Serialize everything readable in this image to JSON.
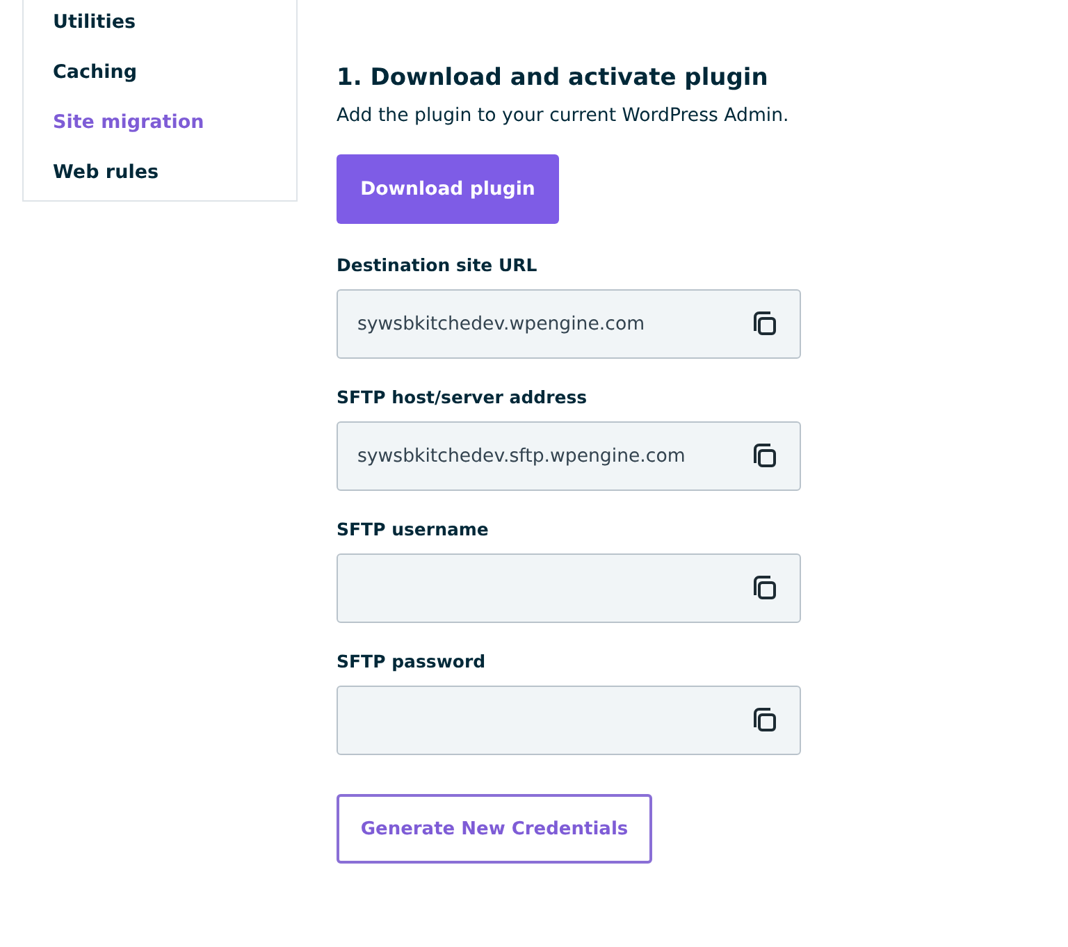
{
  "sidebar": {
    "items": [
      {
        "label": "Utilities",
        "selected": false
      },
      {
        "label": "Caching",
        "selected": false
      },
      {
        "label": "Site migration",
        "selected": true
      },
      {
        "label": "Web rules",
        "selected": false
      }
    ]
  },
  "section": {
    "heading": "1. Download and activate plugin",
    "description": "Add the plugin to your current WordPress Admin.",
    "button": "Download plugin"
  },
  "fields": [
    {
      "label": "Destination site URL",
      "value": "sywsbkitchedev.wpengine.com"
    },
    {
      "label": "SFTP host/server address",
      "value": "sywsbkitchedev.sftp.wpengine.com"
    },
    {
      "label": "SFTP username"
    },
    {
      "label": "SFTP password"
    }
  ],
  "secondary_button": "Generate New Credentials"
}
